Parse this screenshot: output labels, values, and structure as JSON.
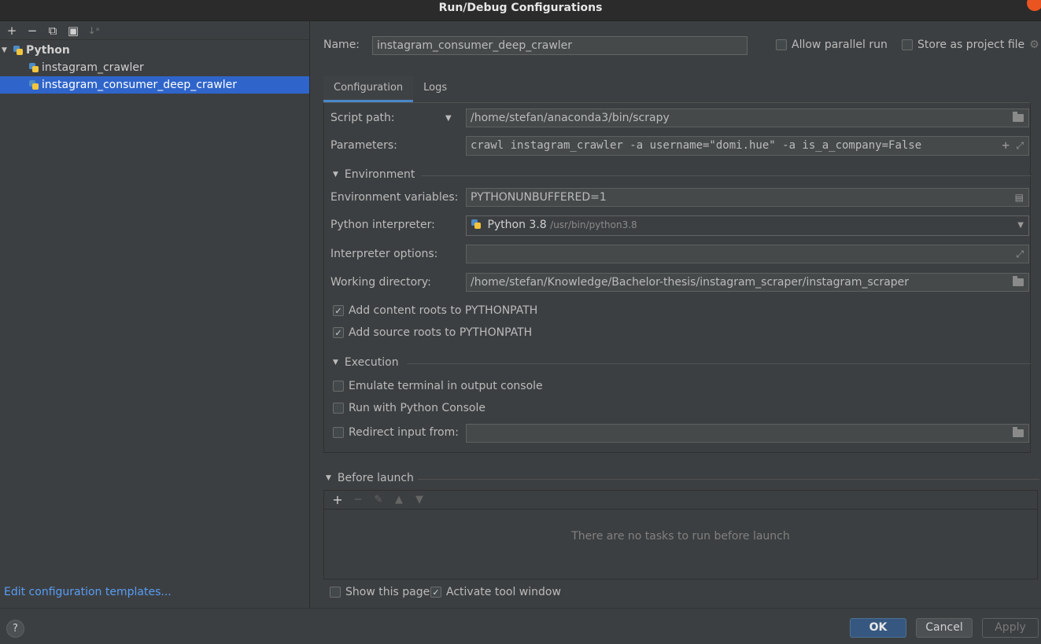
{
  "window": {
    "title": "Run/Debug Configurations"
  },
  "sidebar": {
    "toolbar": [
      "add-icon",
      "remove-icon",
      "copy-icon",
      "folder-add-icon",
      "sort-icon"
    ],
    "group_label": "Python",
    "items": [
      {
        "label": "instagram_crawler",
        "selected": false
      },
      {
        "label": "instagram_consumer_deep_crawler",
        "selected": true
      }
    ],
    "edit_templates": "Edit configuration templates..."
  },
  "header": {
    "name_label": "Name:",
    "name_value": "instagram_consumer_deep_crawler",
    "allow_parallel_label": "Allow parallel run",
    "allow_parallel_checked": false,
    "store_project_label": "Store as project file",
    "store_project_checked": false
  },
  "tabs": [
    {
      "label": "Configuration",
      "active": true
    },
    {
      "label": "Logs",
      "active": false
    }
  ],
  "config": {
    "script_path_label": "Script path:",
    "script_path_value": "/home/stefan/anaconda3/bin/scrapy",
    "parameters_label": "Parameters:",
    "parameters_value": "crawl instagram_crawler -a username=\"domi.hue\" -a is_a_company=False",
    "environment_section": "Environment",
    "env_vars_label": "Environment variables:",
    "env_vars_value": "PYTHONUNBUFFERED=1",
    "interpreter_label": "Python interpreter:",
    "interpreter_name": "Python 3.8",
    "interpreter_path": "/usr/bin/python3.8",
    "interpreter_options_label": "Interpreter options:",
    "interpreter_options_value": "",
    "working_dir_label": "Working directory:",
    "working_dir_value": "/home/stefan/Knowledge/Bachelor-thesis/instagram_scraper/instagram_scraper",
    "content_roots_label": "Add content roots to PYTHONPATH",
    "content_roots_checked": true,
    "source_roots_label": "Add source roots to PYTHONPATH",
    "source_roots_checked": true,
    "execution_section": "Execution",
    "emulate_terminal_label": "Emulate terminal in output console",
    "emulate_terminal_checked": false,
    "python_console_label": "Run with Python Console",
    "python_console_checked": false,
    "redirect_input_label": "Redirect input from:",
    "redirect_input_checked": false,
    "redirect_input_value": ""
  },
  "before_launch": {
    "label": "Before launch",
    "empty_text": "There are no tasks to run before launch",
    "show_page_label": "Show this page",
    "show_page_checked": false,
    "activate_tool_label": "Activate tool window",
    "activate_tool_checked": true
  },
  "footer": {
    "help": "?",
    "ok": "OK",
    "cancel": "Cancel",
    "apply": "Apply"
  },
  "colors": {
    "accent": "#2f65ca",
    "link": "#589df6",
    "ok_button": "#365880",
    "close_button": "#e95420"
  }
}
